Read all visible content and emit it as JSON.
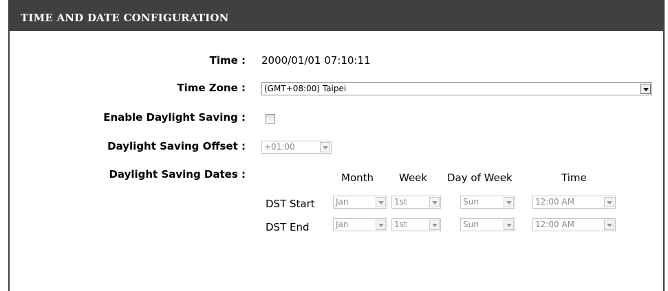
{
  "header": {
    "title": "TIME AND DATE CONFIGURATION"
  },
  "fields": {
    "time": {
      "label": "Time :",
      "value": "2000/01/01 07:10:11"
    },
    "time_zone": {
      "label": "Time Zone :",
      "value": "(GMT+08:00) Taipei"
    },
    "enable_dst": {
      "label": "Enable Daylight Saving :",
      "checked": false
    },
    "dst_offset": {
      "label": "Daylight Saving Offset :",
      "value": "+01:00"
    },
    "dst_dates": {
      "label": "Daylight Saving Dates :"
    }
  },
  "dst_table": {
    "columns": {
      "month": "Month",
      "week": "Week",
      "day_of_week": "Day of Week",
      "time": "Time"
    },
    "start": {
      "label": "DST Start",
      "month": "Jan",
      "week": "1st",
      "day": "Sun",
      "time": "12:00 AM"
    },
    "end": {
      "label": "DST End",
      "month": "Jan",
      "week": "1st",
      "day": "Sun",
      "time": "12:00 AM"
    }
  }
}
